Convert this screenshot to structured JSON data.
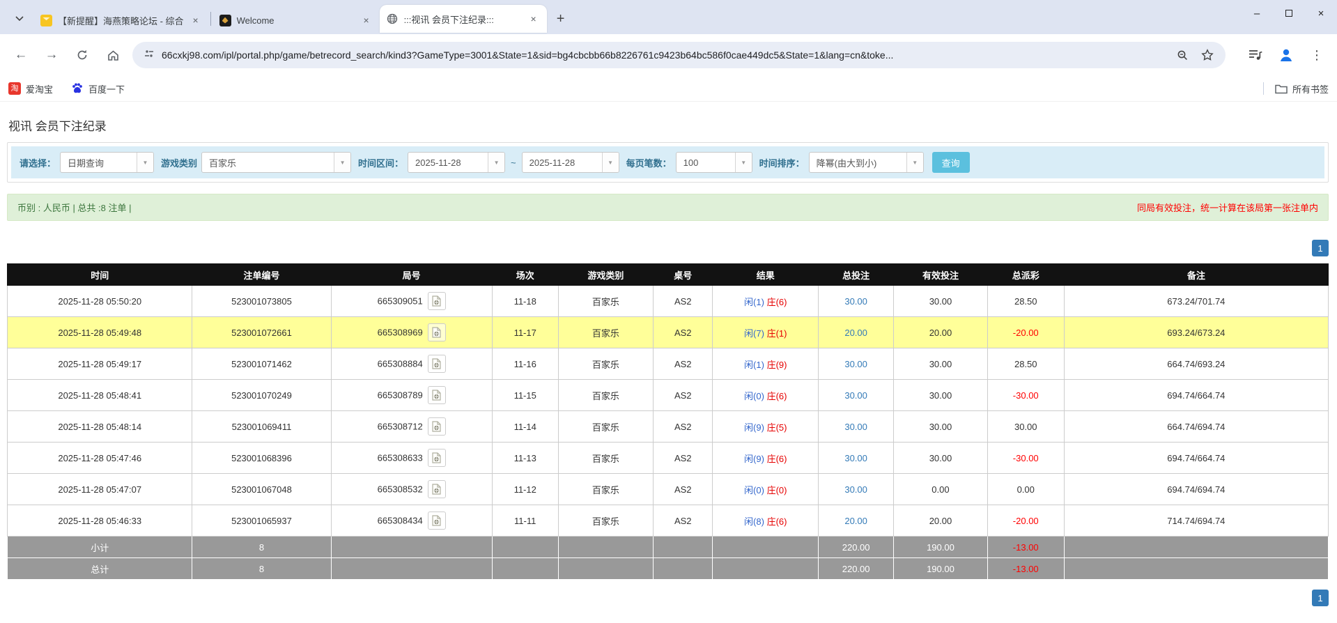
{
  "colors": {
    "accent_button": "#5bc0de",
    "highlight_row": "#ffff99",
    "pagination_blue": "#337ab7",
    "negative_red": "#ff0000",
    "player_blue": "#3366cc",
    "banker_red": "#e60000",
    "filter_bar_bg": "#d9edf7",
    "summary_bar_bg": "#dff0d8",
    "table_header_bg": "#121212",
    "summary_row_bg": "#999999"
  },
  "browser": {
    "tabs": [
      {
        "title": "【新提醒】海燕策略论坛 - 综合"
      },
      {
        "title": "Welcome"
      },
      {
        "title": ":::视讯 会员下注纪录:::"
      }
    ],
    "url": "66cxkj98.com/ipl/portal.php/game/betrecord_search/kind3?GameType=3001&State=1&sid=bg4cbcbb66b8226761c9423b64bc586f0cae449dc5&State=1&lang=cn&toke...",
    "bookmarks": [
      {
        "label": "爱淘宝",
        "icon": "taobao-icon",
        "icon_glyph": "淘"
      },
      {
        "label": "百度一下",
        "icon": "baidu-paw-icon"
      }
    ],
    "all_bookmarks_label": "所有书签"
  },
  "page": {
    "title": "视讯 会员下注纪录",
    "filters": {
      "select_label": "请选择：",
      "select_value": "日期查询",
      "game_type_label": "游戏类别",
      "game_type_value": "百家乐",
      "time_range_label": "时间区间：",
      "date_from": "2025-11-28",
      "tilde": "~",
      "date_to": "2025-11-28",
      "per_page_label": "每页笔数：",
      "per_page_value": "100",
      "sort_label": "时间排序：",
      "sort_value": "降幂(由大到小)",
      "search_button": "查询"
    },
    "summary_bar": {
      "left": "币别 : 人民币 | 总共 :8 注单 |",
      "right": "同局有效投注，统一计算在该局第一张注单内"
    },
    "pagination": "1",
    "table": {
      "headers": [
        "时间",
        "注单编号",
        "局号",
        "场次",
        "游戏类别",
        "桌号",
        "结果",
        "总投注",
        "有效投注",
        "总派彩",
        "备注"
      ],
      "rows": [
        {
          "time": "2025-11-28 05:50:20",
          "bet_id": "523001073805",
          "round_id": "665309051",
          "session": "11-18",
          "game": "百家乐",
          "table": "AS2",
          "result_player": "闲(1)",
          "result_banker": "庄(6)",
          "total_bet": "30.00",
          "valid_bet": "30.00",
          "payout": "28.50",
          "note": "673.24/701.74",
          "highlighted": false
        },
        {
          "time": "2025-11-28 05:49:48",
          "bet_id": "523001072661",
          "round_id": "665308969",
          "session": "11-17",
          "game": "百家乐",
          "table": "AS2",
          "result_player": "闲(7)",
          "result_banker": "庄(1)",
          "total_bet": "20.00",
          "valid_bet": "20.00",
          "payout": "-20.00",
          "note": "693.24/673.24",
          "highlighted": true
        },
        {
          "time": "2025-11-28 05:49:17",
          "bet_id": "523001071462",
          "round_id": "665308884",
          "session": "11-16",
          "game": "百家乐",
          "table": "AS2",
          "result_player": "闲(1)",
          "result_banker": "庄(9)",
          "total_bet": "30.00",
          "valid_bet": "30.00",
          "payout": "28.50",
          "note": "664.74/693.24",
          "highlighted": false
        },
        {
          "time": "2025-11-28 05:48:41",
          "bet_id": "523001070249",
          "round_id": "665308789",
          "session": "11-15",
          "game": "百家乐",
          "table": "AS2",
          "result_player": "闲(0)",
          "result_banker": "庄(6)",
          "total_bet": "30.00",
          "valid_bet": "30.00",
          "payout": "-30.00",
          "note": "694.74/664.74",
          "highlighted": false
        },
        {
          "time": "2025-11-28 05:48:14",
          "bet_id": "523001069411",
          "round_id": "665308712",
          "session": "11-14",
          "game": "百家乐",
          "table": "AS2",
          "result_player": "闲(9)",
          "result_banker": "庄(5)",
          "total_bet": "30.00",
          "valid_bet": "30.00",
          "payout": "30.00",
          "note": "664.74/694.74",
          "highlighted": false
        },
        {
          "time": "2025-11-28 05:47:46",
          "bet_id": "523001068396",
          "round_id": "665308633",
          "session": "11-13",
          "game": "百家乐",
          "table": "AS2",
          "result_player": "闲(9)",
          "result_banker": "庄(6)",
          "total_bet": "30.00",
          "valid_bet": "30.00",
          "payout": "-30.00",
          "note": "694.74/664.74",
          "highlighted": false
        },
        {
          "time": "2025-11-28 05:47:07",
          "bet_id": "523001067048",
          "round_id": "665308532",
          "session": "11-12",
          "game": "百家乐",
          "table": "AS2",
          "result_player": "闲(0)",
          "result_banker": "庄(0)",
          "total_bet": "30.00",
          "valid_bet": "0.00",
          "payout": "0.00",
          "note": "694.74/694.74",
          "highlighted": false
        },
        {
          "time": "2025-11-28 05:46:33",
          "bet_id": "523001065937",
          "round_id": "665308434",
          "session": "11-11",
          "game": "百家乐",
          "table": "AS2",
          "result_player": "闲(8)",
          "result_banker": "庄(6)",
          "total_bet": "20.00",
          "valid_bet": "20.00",
          "payout": "-20.00",
          "note": "714.74/694.74",
          "highlighted": false
        }
      ],
      "subtotal": {
        "label": "小计",
        "count": "8",
        "total_bet": "220.00",
        "valid_bet": "190.00",
        "payout": "-13.00"
      },
      "total": {
        "label": "总计",
        "count": "8",
        "total_bet": "220.00",
        "valid_bet": "190.00",
        "payout": "-13.00"
      }
    }
  }
}
